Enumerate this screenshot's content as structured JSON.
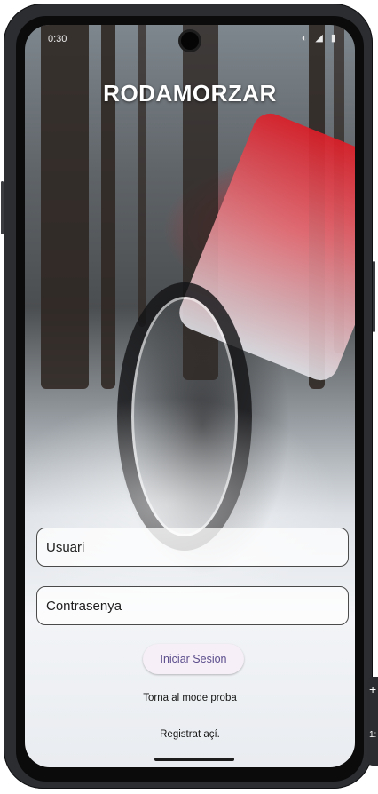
{
  "status_bar": {
    "time": "0:30",
    "icons": "◐ ◢ ▮"
  },
  "app": {
    "title": "RODAMORZAR"
  },
  "form": {
    "username_placeholder": "Usuari",
    "password_placeholder": "Contrasenya",
    "login_button": "Iniciar Sesion",
    "test_mode_link": "Torna al mode proba",
    "register_link": "Registrat açí."
  },
  "side_toolbar": {
    "plus": "+",
    "label": "1:"
  }
}
